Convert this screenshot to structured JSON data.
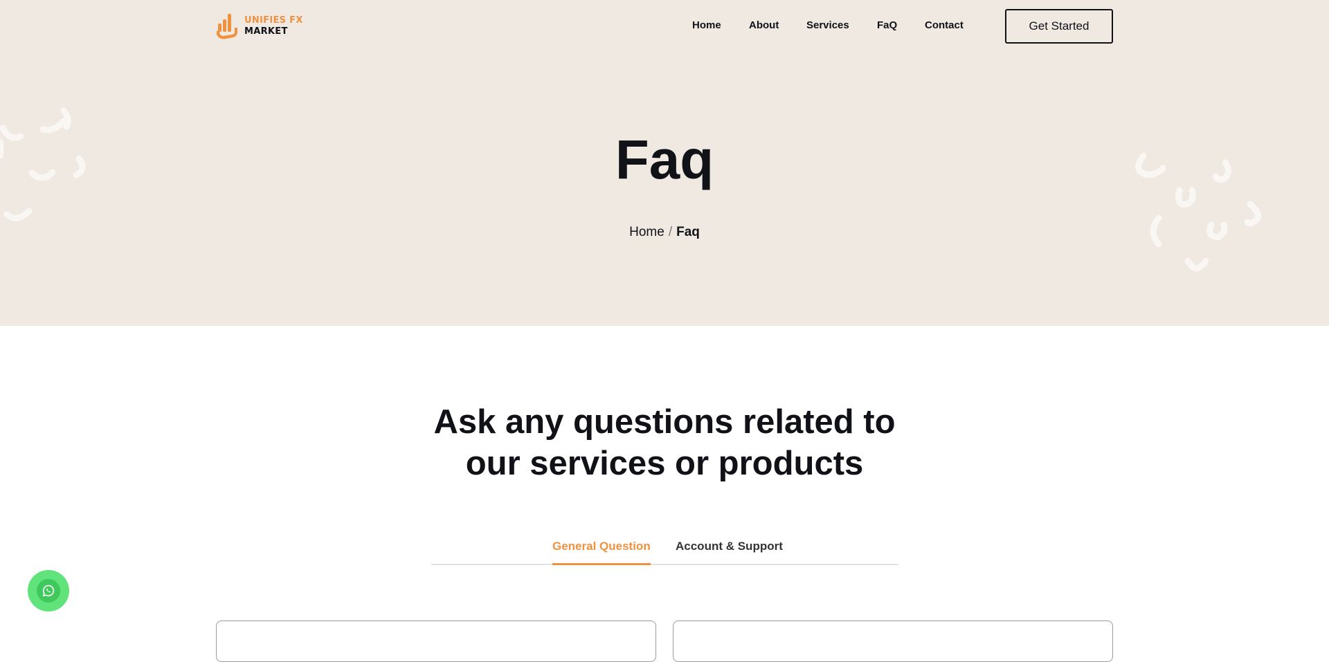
{
  "brand": {
    "line1": "UNIFIES FX",
    "line2": "MARKET",
    "accent": "#f0913f"
  },
  "nav": {
    "items": [
      "Home",
      "About",
      "Services",
      "FaQ",
      "Contact"
    ]
  },
  "header": {
    "cta_label": "Get Started"
  },
  "hero": {
    "title": "Faq",
    "breadcrumb": {
      "home": "Home",
      "separator": "/",
      "current": "Faq"
    },
    "background": "#f0e9e2"
  },
  "faq": {
    "heading_line1": "Ask any questions related to",
    "heading_line2": "our services or products",
    "tabs": [
      {
        "label": "General Question",
        "active": true
      },
      {
        "label": "Account & Support",
        "active": false
      }
    ]
  },
  "floating": {
    "whatsapp_icon": "whatsapp-icon",
    "color": "#5fe37a"
  }
}
